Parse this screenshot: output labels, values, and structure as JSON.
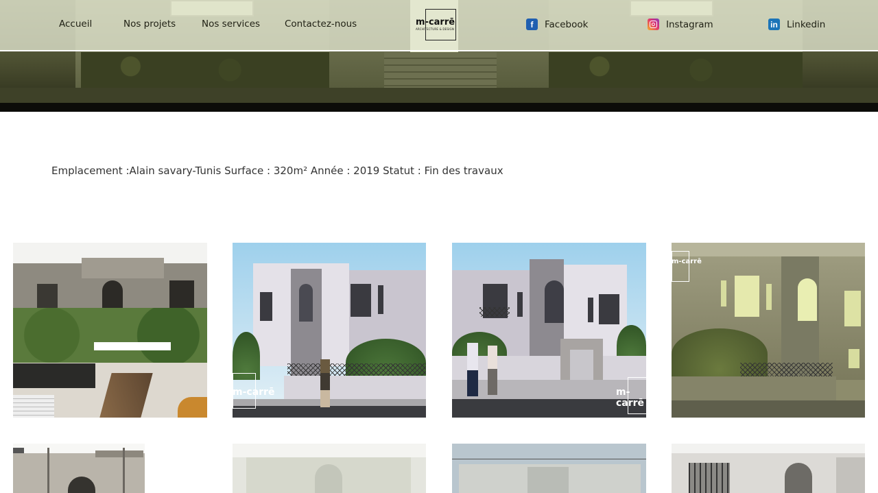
{
  "nav": {
    "links": [
      "Accueil",
      "Nos projets",
      "Nos services",
      "Contactez-nous"
    ],
    "logo": {
      "name": "m-carrē",
      "tagline": "ARCHITECTURE & DESIGN"
    },
    "social": [
      {
        "label": "Facebook",
        "icon": "facebook-icon"
      },
      {
        "label": "Instagram",
        "icon": "instagram-icon"
      },
      {
        "label": "Linkedin",
        "icon": "linkedin-icon"
      }
    ]
  },
  "project": {
    "description": "Emplacement :Alain savary-Tunis Surface : 320m² Année : 2019 Statut : Fin des travaux"
  },
  "gallery": {
    "watermark": "m-carrē",
    "watermark_sub": "ARCHITECTURE & DESIGN"
  },
  "colors": {
    "facebook": "#1f5fb0",
    "linkedin": "#1b74b8",
    "nav_text": "#1f2014"
  }
}
